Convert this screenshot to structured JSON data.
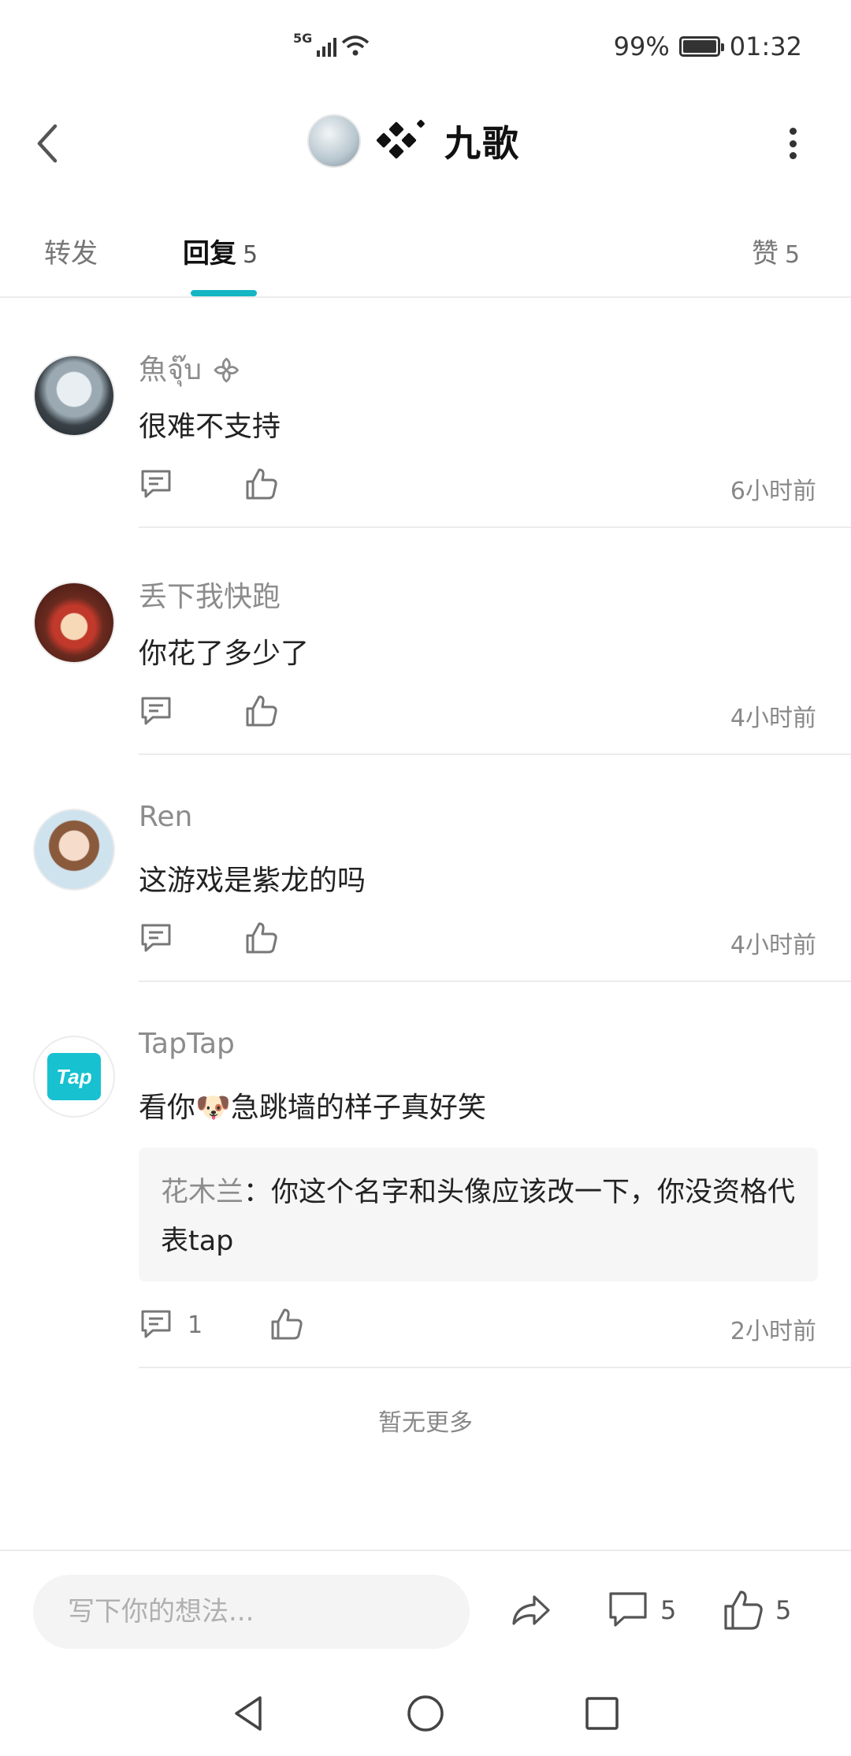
{
  "status_bar": {
    "network": "5G",
    "battery": "99%",
    "time": "01:32"
  },
  "header": {
    "title": "九歌"
  },
  "tabs": [
    {
      "label": "转发",
      "count": ""
    },
    {
      "label": "回复",
      "count": "5"
    },
    {
      "label": "赞",
      "count": "5"
    }
  ],
  "comments": [
    {
      "name": "魚จุ๊บ ᯽",
      "text": "很难不支持",
      "reply_count": "",
      "time": "6小时前"
    },
    {
      "name": "丢下我快跑",
      "text": "你花了多少了",
      "reply_count": "",
      "time": "4小时前"
    },
    {
      "name": "Ren",
      "text": "这游戏是紫龙的吗",
      "reply_count": "",
      "time": "4小时前"
    },
    {
      "name": "TapTap",
      "text_before": "看你",
      "emoji": "🐶",
      "text_after": "急跳墙的样子真好笑",
      "quote_name": "花木兰",
      "quote_sep": "：",
      "quote_text": "你这个名字和头像应该改一下，你没资格代表tap",
      "reply_count": "1",
      "time": "2小时前",
      "avatar_text": "Tap"
    }
  ],
  "no_more": "暂无更多",
  "bottom_bar": {
    "placeholder": "写下你的想法...",
    "comment_count": "5",
    "like_count": "5"
  },
  "colors": {
    "accent": "#15b5c4",
    "taptap_brand": "#17c1d0"
  }
}
